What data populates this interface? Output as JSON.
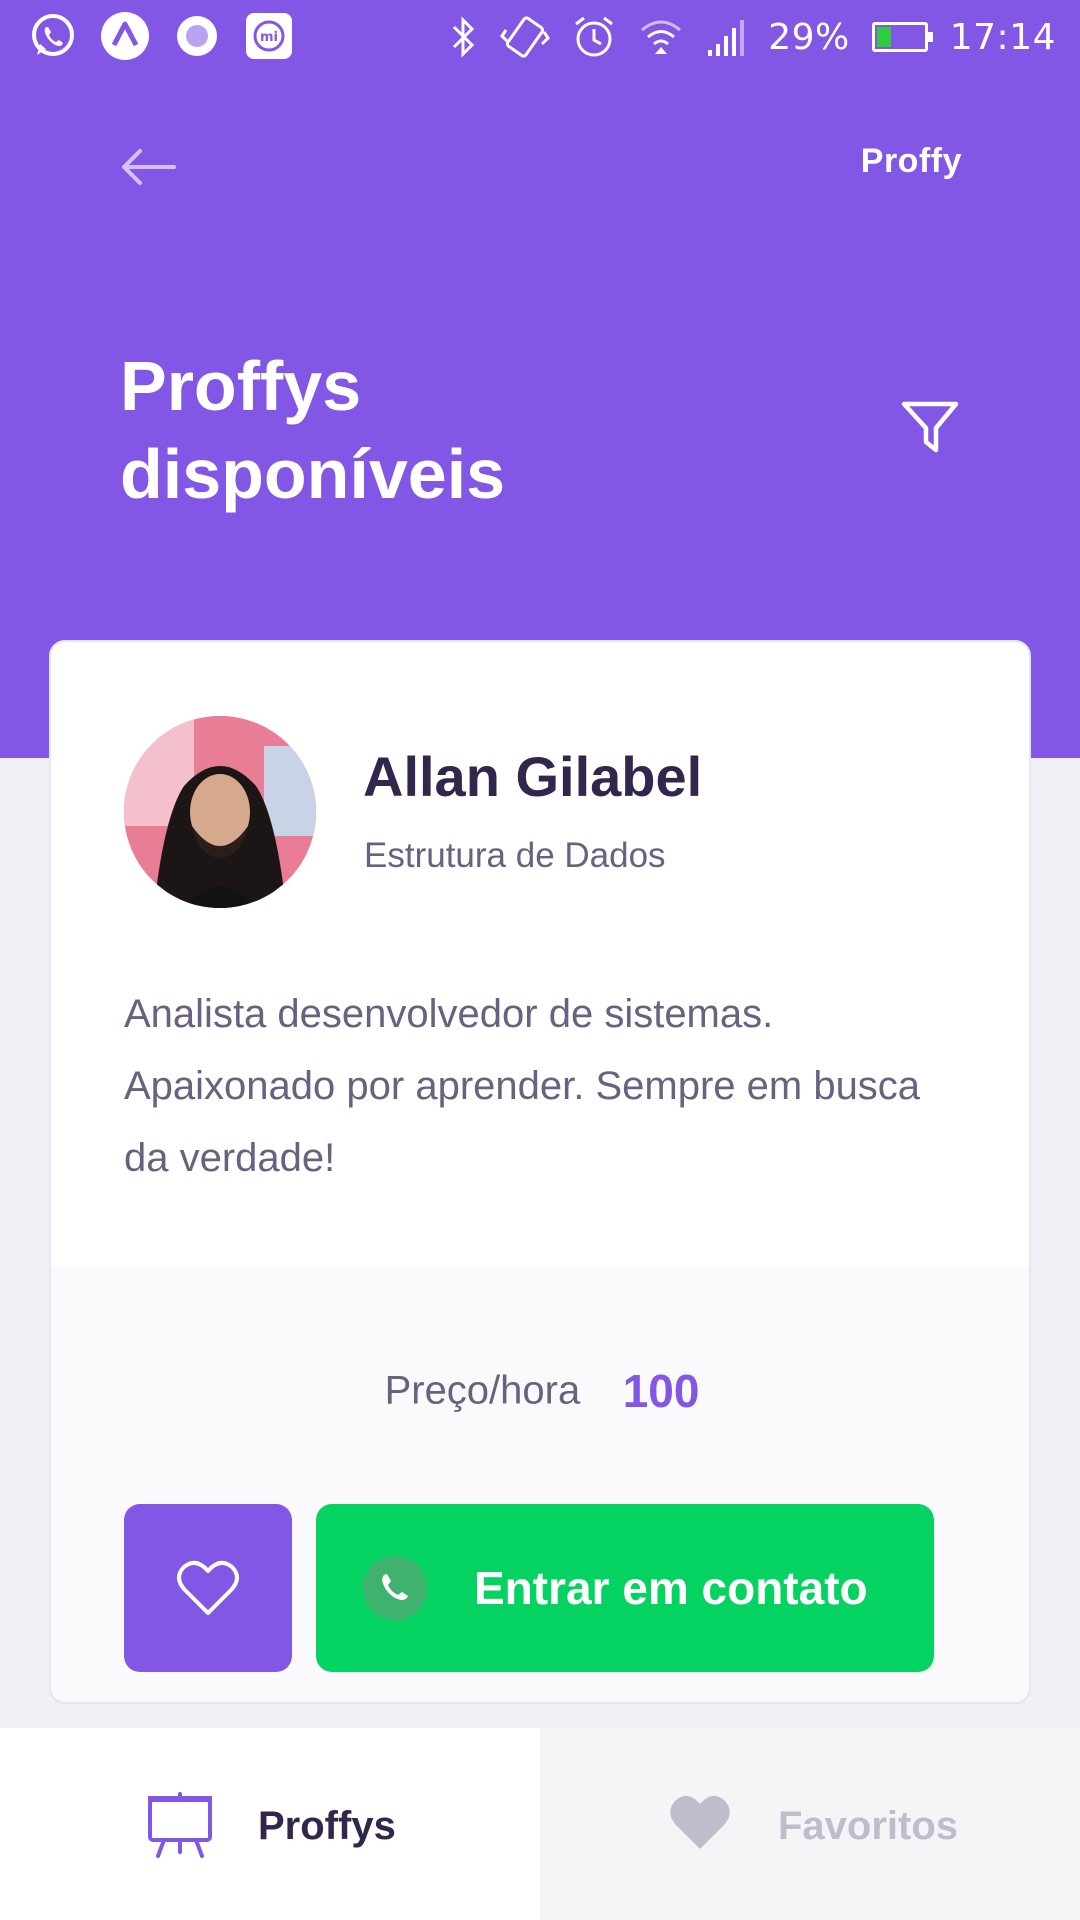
{
  "status_bar": {
    "battery": "29%",
    "time": "17:14",
    "left_icons": [
      "whatsapp-icon",
      "expo-icon",
      "circle-app-icon",
      "mi-icon"
    ],
    "right_icons": [
      "bluetooth-icon",
      "vibrate-icon",
      "alarm-icon",
      "wifi-icon",
      "signal-icon",
      "battery-icon"
    ]
  },
  "header": {
    "back_icon": "arrow-left-icon",
    "logo": "Proffy",
    "title": "Proffys disponíveis",
    "filter_icon": "filter-icon"
  },
  "teacher_card": {
    "name": "Allan Gilabel",
    "subject": "Estrutura de Dados",
    "bio": "Analista desenvolvedor de sistemas. Apaixonado por aprender. Sempre em busca da verdade!",
    "price_label": "Preço/hora",
    "price_value": "100",
    "favorite_icon": "heart-outline-icon",
    "contact_label": "Entrar em contato",
    "contact_icon": "whatsapp-icon"
  },
  "tabs": [
    {
      "label": "Proffys",
      "icon": "easel-icon",
      "active": true
    },
    {
      "label": "Favoritos",
      "icon": "heart-icon",
      "active": false
    }
  ],
  "colors": {
    "primary": "#8257E5",
    "secondary": "#04D361",
    "title_text": "#32264D",
    "body_text": "#6A6180",
    "inactive": "#C1BCCC"
  }
}
